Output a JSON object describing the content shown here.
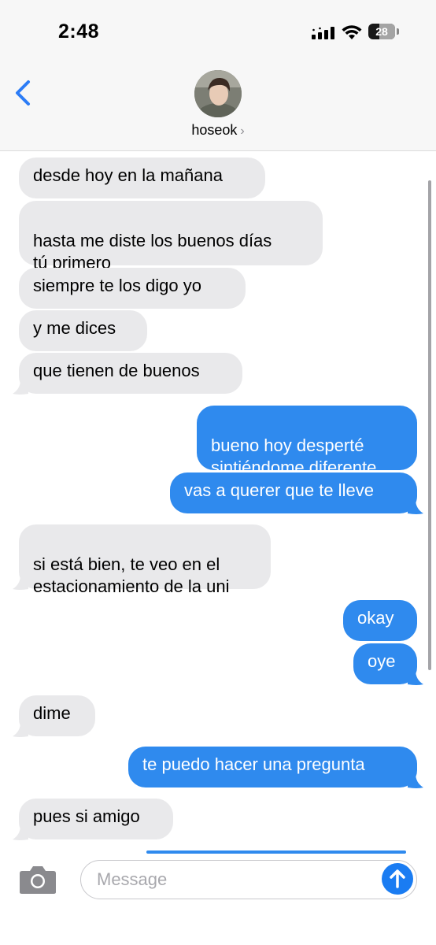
{
  "status_bar": {
    "time": "2:48",
    "battery": "28"
  },
  "header": {
    "contact_name": "hoseok",
    "chevron": "›"
  },
  "messages": [
    {
      "from": "them",
      "text": "desde hoy en la mañana"
    },
    {
      "from": "them",
      "text": "hasta me diste los buenos días\ntú primero"
    },
    {
      "from": "them",
      "text": "siempre te los digo yo"
    },
    {
      "from": "them",
      "text": "y me dices"
    },
    {
      "from": "them",
      "text": "que tienen de buenos"
    },
    {
      "from": "me",
      "text": "bueno hoy desperté\nsintiéndome diferente"
    },
    {
      "from": "me",
      "text": "vas a querer que te lleve"
    },
    {
      "from": "them",
      "text": "si está bien, te veo en el\nestacionamiento de la uni"
    },
    {
      "from": "me",
      "text": "okay"
    },
    {
      "from": "me",
      "text": "oye"
    },
    {
      "from": "them",
      "text": "dime"
    },
    {
      "from": "me",
      "text": "te puedo hacer una pregunta"
    },
    {
      "from": "them",
      "text": "pues si amigo"
    }
  ],
  "composer": {
    "placeholder": "Message"
  },
  "icons": {
    "back": "chevron-left-icon",
    "camera": "camera-icon",
    "send": "arrow-up-icon",
    "signal": "cellular-signal-icon",
    "wifi": "wifi-icon",
    "battery": "battery-icon"
  },
  "colors": {
    "incoming_bubble": "#e9e9eb",
    "outgoing_bubble": "#2f8aee",
    "accent": "#1a7cf2"
  }
}
